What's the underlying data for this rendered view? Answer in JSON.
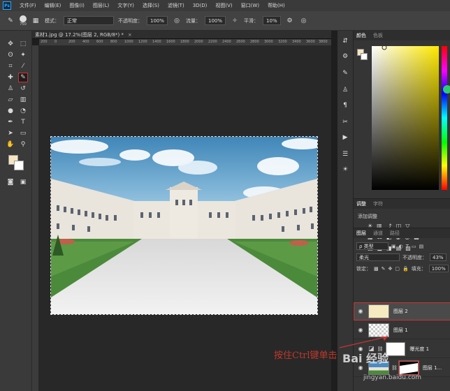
{
  "menubar": {
    "logo": "Ps",
    "items": [
      "文件(F)",
      "编辑(E)",
      "图像(I)",
      "图层(L)",
      "文字(Y)",
      "选择(S)",
      "滤镜(T)",
      "3D(D)",
      "视图(V)",
      "窗口(W)",
      "帮助(H)"
    ]
  },
  "options": {
    "brush_size": "750",
    "mode_label": "模式：",
    "mode_value": "正常",
    "opacity_label": "不透明度：",
    "opacity_value": "100%",
    "flow_label": "流量：",
    "flow_value": "100%",
    "smooth_label": "平滑：",
    "smooth_value": "10%"
  },
  "document": {
    "tab_title": "素材1.jpg @ 17.2%(图层 2, RGB/8*) *",
    "close": "×",
    "ruler_ticks": [
      "200",
      "0",
      "200",
      "400",
      "600",
      "800",
      "1000",
      "1200",
      "1400",
      "1600",
      "1800",
      "2000",
      "2200",
      "2400",
      "2600",
      "2800",
      "3000",
      "3200",
      "3400",
      "3600",
      "3800"
    ]
  },
  "color_panel": {
    "tabs": [
      "颜色",
      "色板"
    ],
    "fg_color": "#f6e5c3",
    "bg_color": "#ffffff"
  },
  "adjust_panel": {
    "tabs": [
      "调整",
      "字符"
    ],
    "add_label": "添加调整"
  },
  "layers_panel": {
    "tabs": [
      "图层",
      "通道",
      "路径"
    ],
    "filter_label": "ρ 类型",
    "blend_mode": "柔光",
    "opacity_label": "不透明度：",
    "opacity_value": "43%",
    "lock_label": "锁定：",
    "fill_label": "填充：",
    "fill_value": "100%",
    "layers": [
      {
        "name": "图层 2",
        "selected": true
      },
      {
        "name": "图层 1",
        "selected": false
      },
      {
        "name": "曝光度 1",
        "selected": false
      },
      {
        "name": "图层 1...",
        "selected": false
      }
    ]
  },
  "annotation": "按住Ctrl键单击",
  "watermark": {
    "text": "Bai 经验",
    "url": "jingyan.baidu.com"
  },
  "colors": {
    "accent_red": "#c33333"
  }
}
